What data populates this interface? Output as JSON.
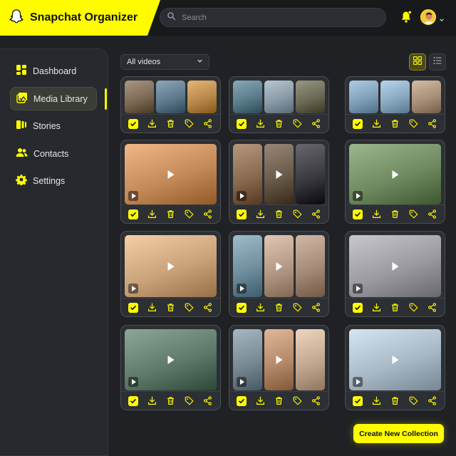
{
  "app": {
    "title": "Snapchat Organizer"
  },
  "search": {
    "placeholder": "Search"
  },
  "sidebar": {
    "items": [
      {
        "label": "Dashboard",
        "icon": "dashboard-icon",
        "active": false
      },
      {
        "label": "Media Library",
        "icon": "media-library-icon",
        "active": true
      },
      {
        "label": "Stories",
        "icon": "stories-icon",
        "active": false
      },
      {
        "label": "Contacts",
        "icon": "contacts-icon",
        "active": false
      },
      {
        "label": "Settings",
        "icon": "gear-icon",
        "active": false
      }
    ]
  },
  "filter": {
    "selected": "All videos"
  },
  "view": {
    "mode": "grid"
  },
  "actions": {
    "create_collection": "Create New Collection"
  },
  "colors": {
    "accent": "#fffc00",
    "background": "#1f2124",
    "card": "#2c2f33"
  },
  "cards": [
    {
      "thumbs": [
        "#7d6a55",
        "#5f7a8c",
        "#b8894a"
      ],
      "selected": true
    },
    {
      "thumbs": [
        "#5b7c8a",
        "#8a9aa6",
        "#6b6a55"
      ],
      "selected": true
    },
    {
      "thumbs": [
        "#7fa0b8",
        "#8aa9c0",
        "#a78f78"
      ],
      "selected": true
    },
    {
      "thumbs": [
        "#c48a5a"
      ],
      "selected": true
    },
    {
      "thumbs": [
        "#8a6a50",
        "#6a5a4a",
        "#3a3a40"
      ],
      "selected": true
    },
    {
      "thumbs": [
        "#6f8a60"
      ],
      "selected": true
    },
    {
      "thumbs": [
        "#c9a27a"
      ],
      "selected": true
    },
    {
      "thumbs": [
        "#6f8f9e",
        "#b49a86",
        "#a58a78"
      ],
      "selected": true
    },
    {
      "thumbs": [
        "#9a9aa0"
      ],
      "selected": true
    },
    {
      "thumbs": [
        "#5e7a6a"
      ],
      "selected": true
    },
    {
      "thumbs": [
        "#7a8a95",
        "#b58a6a",
        "#c2a890"
      ],
      "selected": true
    },
    {
      "thumbs": [
        "#a8b8c4"
      ],
      "selected": true
    }
  ]
}
